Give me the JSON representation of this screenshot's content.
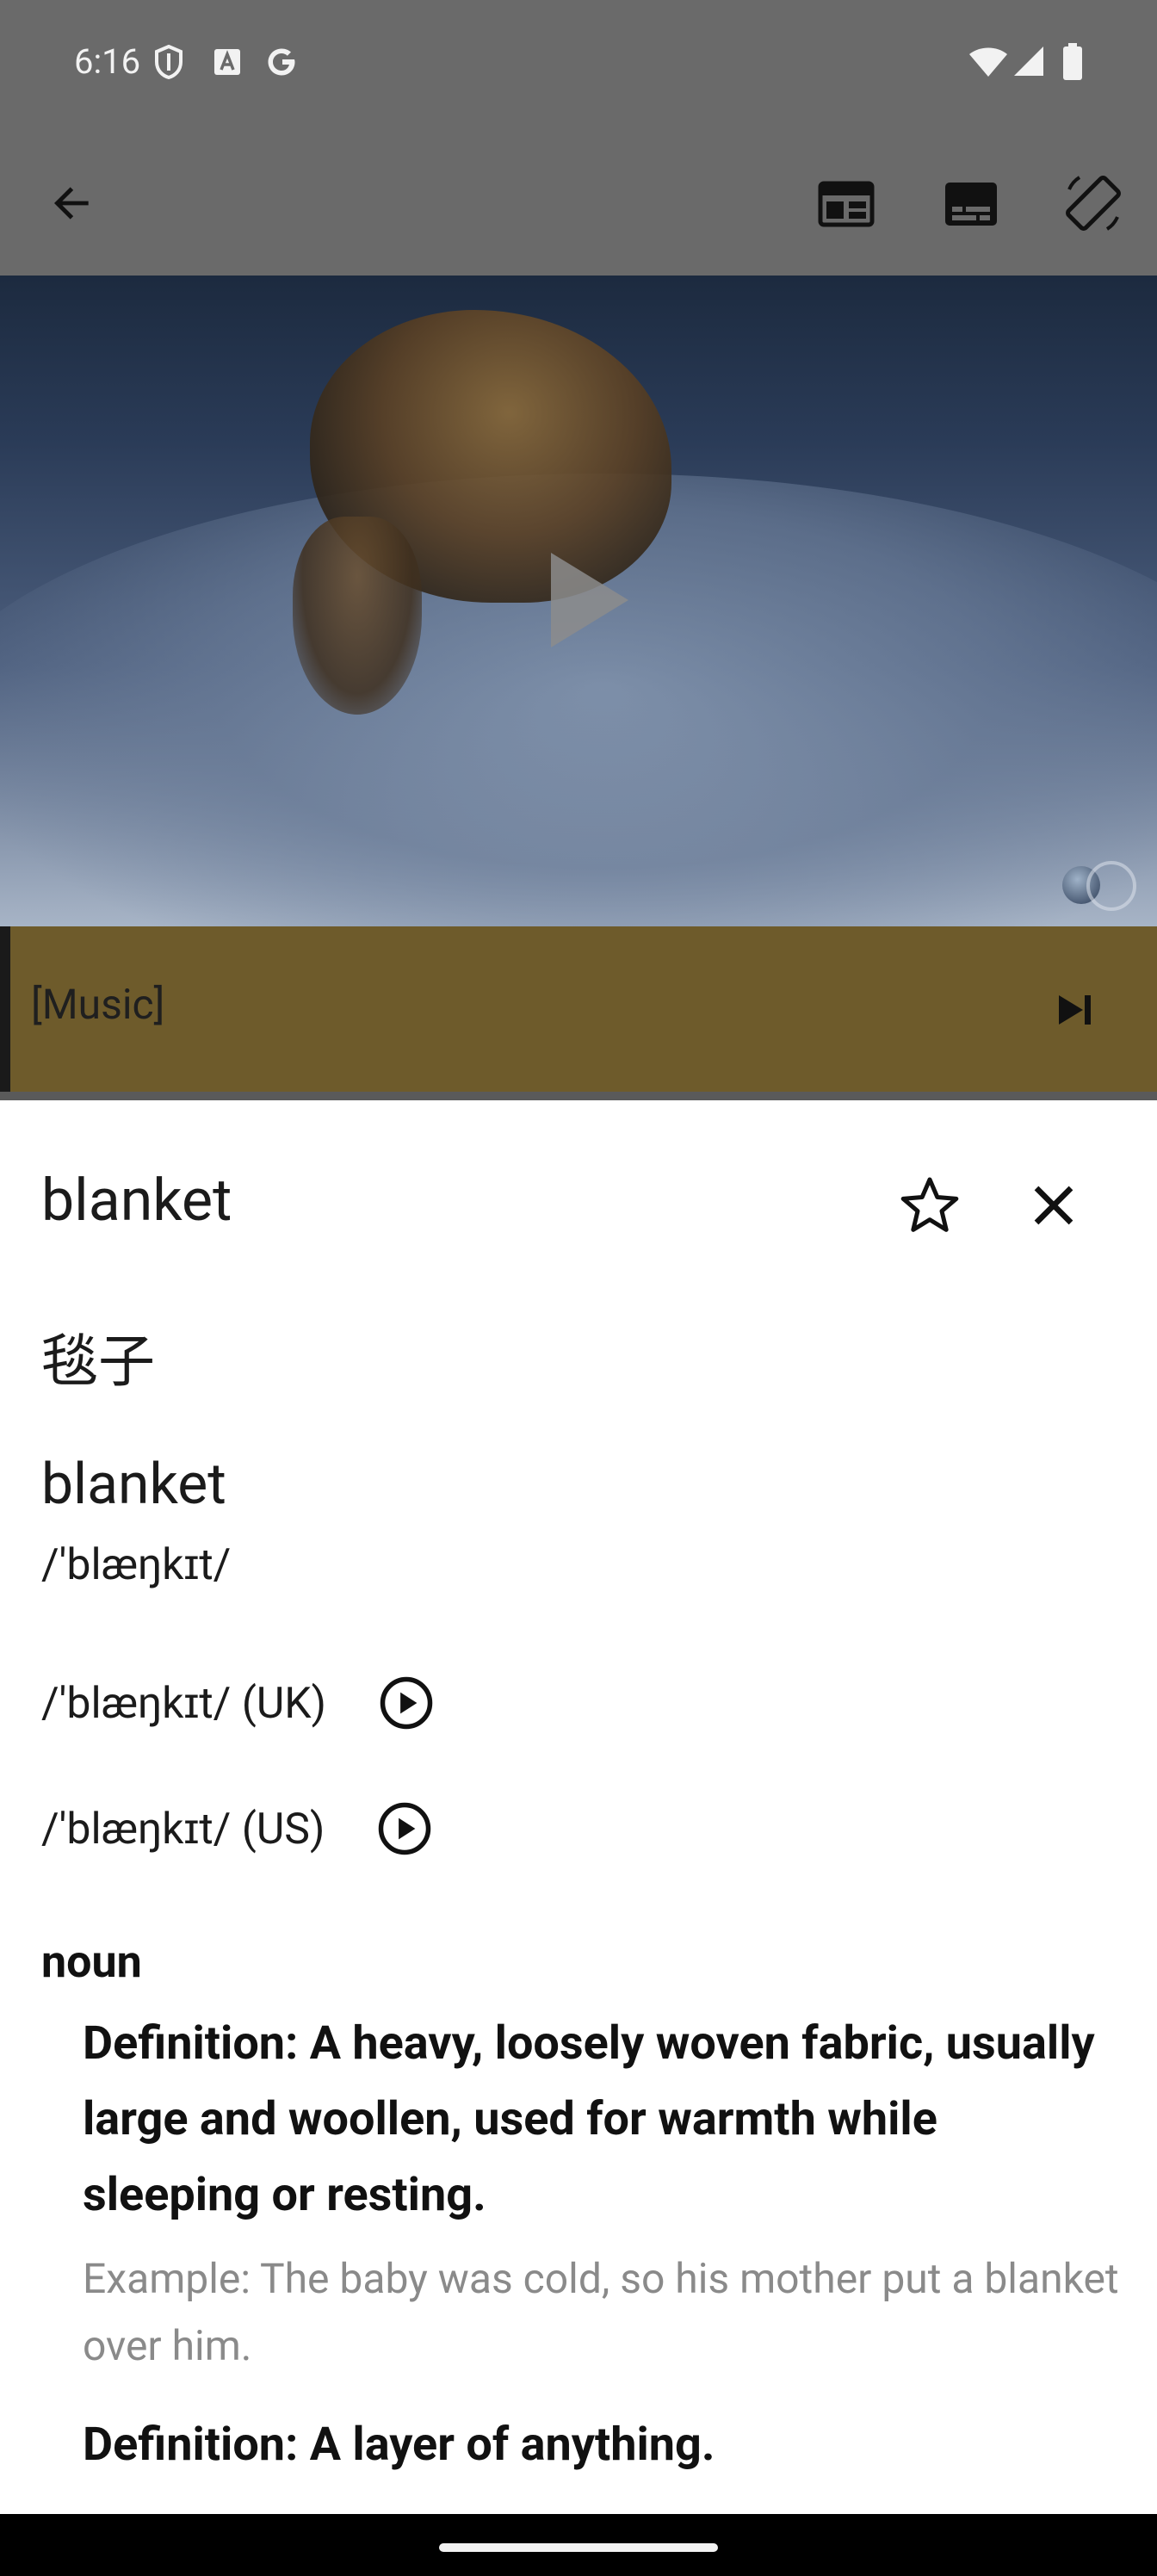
{
  "status_bar": {
    "time": "6:16"
  },
  "toolbar": {
    "back_icon": "arrow-back-icon",
    "icons": [
      "web-layout-icon",
      "subtitles-icon",
      "screen-rotation-icon"
    ]
  },
  "video": {
    "state": "paused"
  },
  "caption": {
    "text": "[Music]",
    "accent_color": "#6e5b2b"
  },
  "dictionary": {
    "word": "blanket",
    "translation": "毯子",
    "entry_word": "blanket",
    "phonetic": "/'blæŋkɪt/",
    "pronunciations": [
      {
        "label": "/'blæŋkɪt/ (UK)"
      },
      {
        "label": "/'blæŋkɪt/ (US)"
      }
    ],
    "part_of_speech": "noun",
    "definitions": [
      {
        "text": "Definition: A heavy, loosely woven fabric, usually large and woollen, used for warmth while sleeping or resting.",
        "example": "Example: The baby was cold, so his mother put a blanket over him."
      },
      {
        "text": "Definition: A layer of anything."
      }
    ]
  }
}
